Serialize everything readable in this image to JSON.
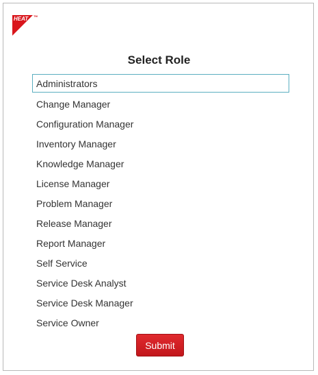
{
  "logo": {
    "text": "HEAT",
    "tm": "TM",
    "color": "#d9161c"
  },
  "title": "Select Role",
  "roles": [
    {
      "label": "Administrators",
      "selected": true
    },
    {
      "label": "Change Manager",
      "selected": false
    },
    {
      "label": "Configuration Manager",
      "selected": false
    },
    {
      "label": "Inventory Manager",
      "selected": false
    },
    {
      "label": "Knowledge Manager",
      "selected": false
    },
    {
      "label": "License Manager",
      "selected": false
    },
    {
      "label": "Problem Manager",
      "selected": false
    },
    {
      "label": "Release Manager",
      "selected": false
    },
    {
      "label": "Report Manager",
      "selected": false
    },
    {
      "label": "Self Service",
      "selected": false
    },
    {
      "label": "Service Desk Analyst",
      "selected": false
    },
    {
      "label": "Service Desk Manager",
      "selected": false
    },
    {
      "label": "Service Owner",
      "selected": false
    }
  ],
  "submit_label": "Submit",
  "colors": {
    "accent": "#d9161c",
    "selection_border": "#5aaec0"
  }
}
